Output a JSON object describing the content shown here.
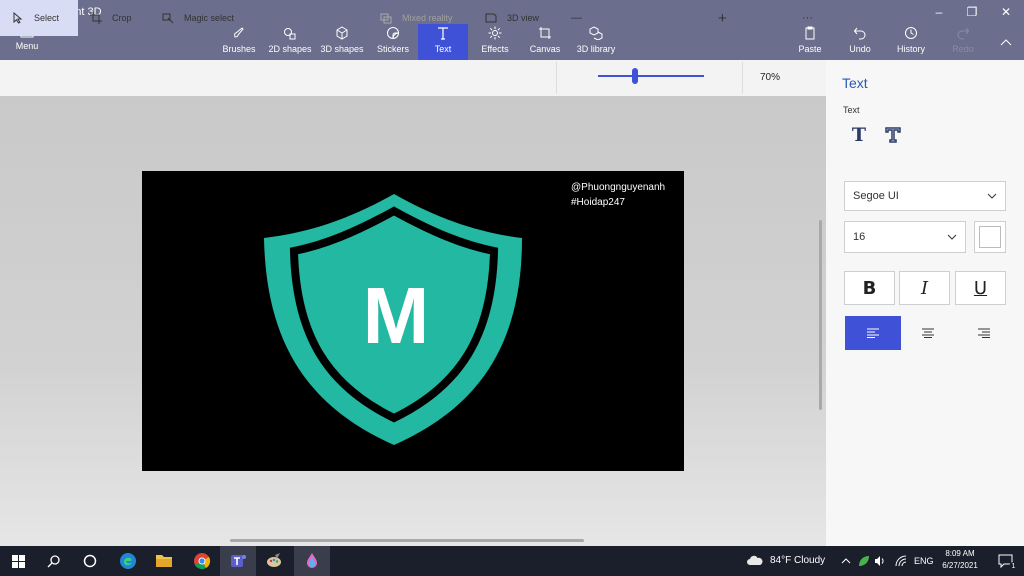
{
  "window": {
    "title": "Untitled* - Paint 3D",
    "minimize": "–",
    "restore": "❐",
    "close": "✕"
  },
  "ribbon": {
    "menu_label": "Menu",
    "items": [
      {
        "label": "Brushes"
      },
      {
        "label": "2D shapes"
      },
      {
        "label": "3D shapes"
      },
      {
        "label": "Stickers"
      },
      {
        "label": "Text"
      },
      {
        "label": "Effects"
      },
      {
        "label": "Canvas"
      },
      {
        "label": "3D library"
      }
    ],
    "right": [
      {
        "label": "Paste"
      },
      {
        "label": "Undo"
      },
      {
        "label": "History"
      },
      {
        "label": "Redo"
      }
    ],
    "active": "Text"
  },
  "toolbar": {
    "select": "Select",
    "crop": "Crop",
    "magic_select": "Magic select",
    "mixed_reality": "Mixed reality",
    "view_3d": "3D view",
    "zoom_out": "—",
    "zoom_in": "+",
    "zoom": "70%",
    "zoom_value": 0.35,
    "more": "···"
  },
  "canvas": {
    "watermark_line1": "@Phuongnguyenanh",
    "watermark_line2": "#Hoidap247",
    "logo_letter": "M",
    "logo_color": "#22b8a2"
  },
  "panel": {
    "title": "Text",
    "subtitle": "Text",
    "font": "Segoe UI",
    "size": "16",
    "bold": "B",
    "italic": "I",
    "underline": "U",
    "text_color": "#ffffff",
    "accent": "#3f51d6"
  },
  "taskbar": {
    "weather": "84°F  Cloudy",
    "lang": "ENG",
    "time": "8:09 AM",
    "date": "6/27/2021",
    "notifications": "1"
  }
}
